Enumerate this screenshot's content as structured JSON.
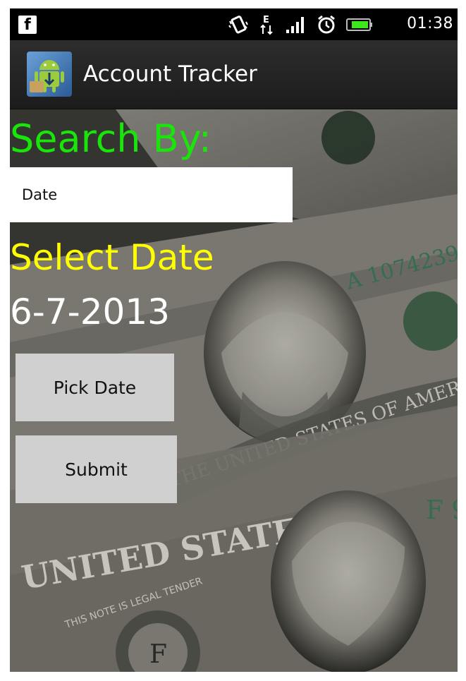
{
  "status_bar": {
    "notification_icon": "facebook-icon",
    "icons": [
      "vibrate-icon",
      "data-e-icon",
      "signal-icon",
      "alarm-icon",
      "battery-icon"
    ],
    "time": "01:38"
  },
  "action_bar": {
    "app_icon": "android-app-icon",
    "title": "Account Tracker"
  },
  "form": {
    "search_label": "Search By:",
    "search_selected": "Date",
    "select_date_label": "Select Date",
    "date_value": "6-7-2013",
    "pick_date_button": "Pick Date",
    "submit_button": "Submit"
  },
  "colors": {
    "search_label": "#19e50a",
    "select_date_label": "#ffff00",
    "date_value": "#ffffff",
    "button_bg": "#d0d0d0",
    "action_bar": "#222222"
  }
}
